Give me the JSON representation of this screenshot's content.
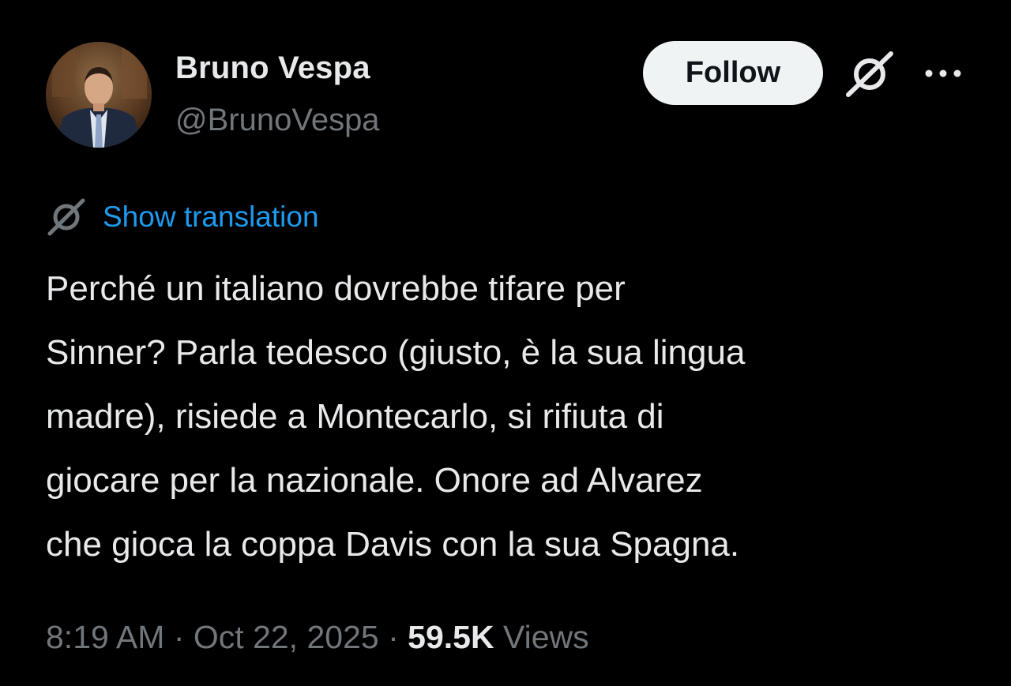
{
  "author": {
    "display_name": "Bruno Vespa",
    "handle": "@BrunoVespa"
  },
  "actions": {
    "follow_label": "Follow",
    "grok_icon": "grok-icon",
    "more_icon": "more-horizontal-icon"
  },
  "translation": {
    "icon": "grok-icon",
    "label": "Show translation"
  },
  "tweet": {
    "text_lines": [
      "Perché un italiano dovrebbe tifare per",
      "Sinner? Parla tedesco (giusto, è la sua lingua",
      "madre), risiede a Montecarlo, si rifiuta di",
      "giocare per la nazionale. Onore ad Alvarez",
      "che gioca la coppa Davis con la sua Spagna."
    ]
  },
  "meta": {
    "time": "8:19 AM",
    "separator": "·",
    "date": "Oct 22, 2025",
    "views_count": "59.5K",
    "views_label": "Views"
  },
  "colors": {
    "background": "#000000",
    "primary_text": "#e7e9ea",
    "secondary_text": "#71767b",
    "link": "#1d9bf0",
    "follow_bg": "#eff3f4"
  }
}
